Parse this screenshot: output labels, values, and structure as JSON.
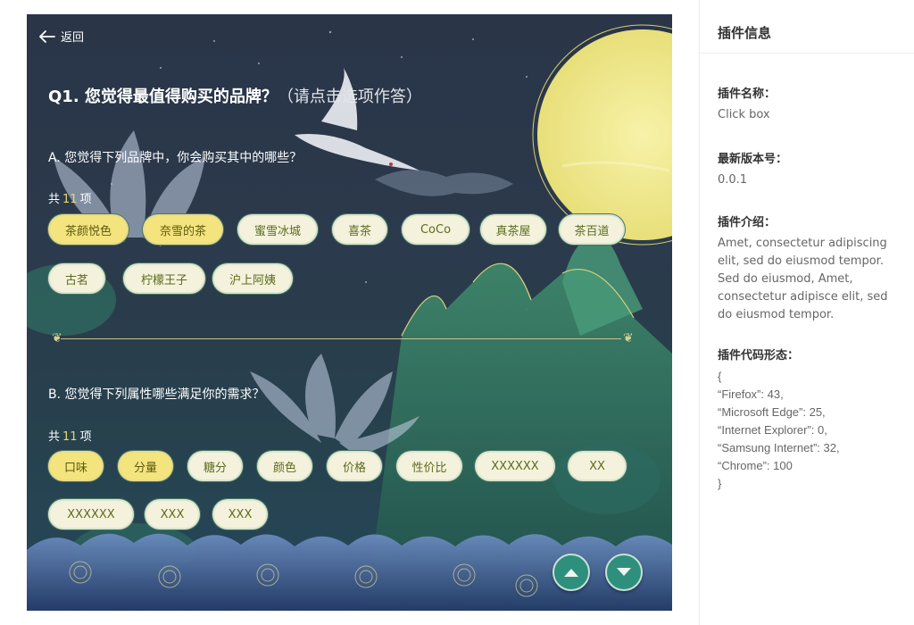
{
  "survey": {
    "back_label": "返回",
    "question_title": "Q1. 您觉得最值得购买的品牌？",
    "question_hint": "（请点击选项作答）",
    "section_a": {
      "title": "A. 您觉得下列品牌中，你会购买其中的哪些？",
      "count_prefix": "共",
      "count_value": "11",
      "count_suffix": "项",
      "options": [
        {
          "label": "茶颜悦色",
          "selected": true
        },
        {
          "label": "奈雪的茶",
          "selected": true
        },
        {
          "label": "蜜雪冰城",
          "selected": false
        },
        {
          "label": "喜茶",
          "selected": false
        },
        {
          "label": "CoCo",
          "selected": false
        },
        {
          "label": "真茶屋",
          "selected": false
        },
        {
          "label": "茶百道",
          "selected": false
        },
        {
          "label": "古茗",
          "selected": false
        },
        {
          "label": "柠檬王子",
          "selected": false
        },
        {
          "label": "沪上阿姨",
          "selected": false
        }
      ]
    },
    "section_b": {
      "title": "B. 您觉得下列属性哪些满足你的需求？",
      "count_prefix": "共",
      "count_value": "11",
      "count_suffix": "项",
      "options": [
        {
          "label": "口味",
          "selected": true
        },
        {
          "label": "分量",
          "selected": true
        },
        {
          "label": "糖分",
          "selected": false
        },
        {
          "label": "颜色",
          "selected": false
        },
        {
          "label": "价格",
          "selected": false
        },
        {
          "label": "性价比",
          "selected": false
        },
        {
          "label": "XXXXXX",
          "selected": false
        },
        {
          "label": "XX",
          "selected": false
        },
        {
          "label": "XXXXXX",
          "selected": false
        },
        {
          "label": "XXX",
          "selected": false
        },
        {
          "label": "XXX",
          "selected": false
        }
      ]
    }
  },
  "panel": {
    "title": "插件信息",
    "name_label": "插件名称：",
    "name_value": "Click box",
    "version_label": "最新版本号：",
    "version_value": "0.0.1",
    "intro_label": "插件介绍：",
    "intro_value": "Amet, consectetur adipiscing elit, sed do eiusmod tempor. Sed do eiusmod, Amet, consectetur adipisce elit, sed do eiusmod tempor.",
    "code_label": "插件代码形态：",
    "code_lines": [
      "{",
      "  “Firefox”: 43,",
      "  “Microsoft Edge”: 25,",
      "  “Internet Explorer”: 0,",
      "  “Samsung Internet”: 32,",
      "  “Chrome”: 100",
      "}"
    ]
  },
  "colors": {
    "chip_selected": "#f3e47e",
    "chip_default": "#f4f2dc",
    "count_accent": "#e4d86a",
    "nav_button": "#2f8f7d",
    "moon": "#f1ea8f"
  },
  "icons": {
    "back": "arrow-left-icon",
    "prev": "chevron-up-icon",
    "next": "chevron-down-icon"
  }
}
